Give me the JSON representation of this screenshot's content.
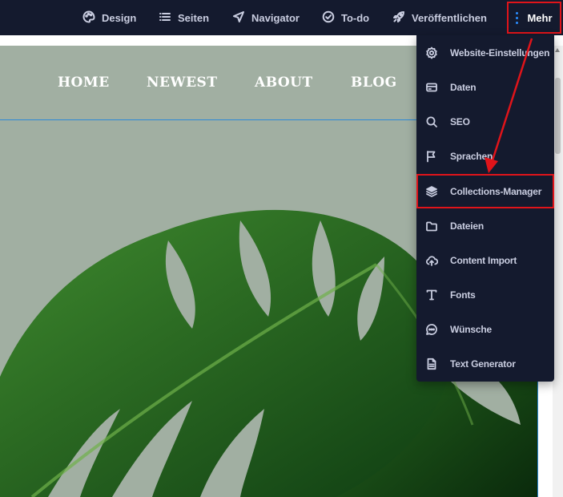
{
  "toolbar": {
    "items": [
      {
        "label": "Design",
        "icon": "palette-icon"
      },
      {
        "label": "Seiten",
        "icon": "list-icon"
      },
      {
        "label": "Navigator",
        "icon": "navigation-arrow-icon"
      },
      {
        "label": "To-do",
        "icon": "check-circle-icon"
      },
      {
        "label": "Veröffentlichen",
        "icon": "rocket-icon"
      }
    ],
    "more_label": "Mehr",
    "more_icon": "kebab-menu-icon"
  },
  "site_nav": {
    "links": [
      "HOME",
      "NEWEST",
      "ABOUT",
      "BLOG"
    ]
  },
  "menu": {
    "items": [
      {
        "label": "Website-Einstellungen",
        "icon": "gear-icon"
      },
      {
        "label": "Daten",
        "icon": "card-icon"
      },
      {
        "label": "SEO",
        "icon": "search-icon"
      },
      {
        "label": "Sprachen",
        "icon": "flag-icon"
      },
      {
        "label": "Collections-Manager",
        "icon": "layers-icon",
        "highlighted": true
      },
      {
        "label": "Dateien",
        "icon": "folder-icon"
      },
      {
        "label": "Content Import",
        "icon": "cloud-upload-icon"
      },
      {
        "label": "Fonts",
        "icon": "text-type-icon"
      },
      {
        "label": "Wünsche",
        "icon": "chat-bubble-icon"
      },
      {
        "label": "Text Generator",
        "icon": "document-icon"
      }
    ]
  },
  "colors": {
    "toolbar_bg": "#141a2e",
    "page_bg": "#a1afa2",
    "highlight": "#e0141a",
    "accent": "#2a8cff"
  }
}
